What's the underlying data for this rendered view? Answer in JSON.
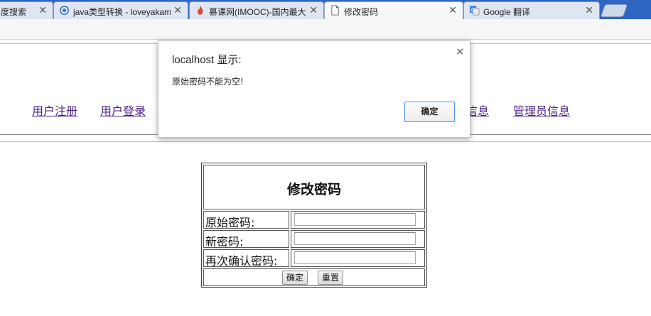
{
  "tabs": [
    {
      "title": "度搜索",
      "favicon": "baidu-icon"
    },
    {
      "title": "java类型转换 - loveyakamoz",
      "favicon": "blog-icon"
    },
    {
      "title": "慕课网(IMOOC)-国内最大",
      "favicon": "imooc-flame-icon"
    },
    {
      "title": "修改密码",
      "favicon": "page-icon",
      "active": true
    },
    {
      "title": "Google 翻译",
      "favicon": "google-translate-icon"
    }
  ],
  "tab_close_glyph": "✕",
  "nav": {
    "register": "用户注册",
    "login": "用户登录",
    "info_partial": "信息",
    "admin_info": "管理员信息"
  },
  "form": {
    "title": "修改密码",
    "old_password_label": "原始密码:",
    "new_password_label": "新密码:",
    "confirm_password_label": "再次确认密码:",
    "old_password_value": "",
    "new_password_value": "",
    "confirm_password_value": "",
    "submit_label": "确定",
    "reset_label": "重置"
  },
  "dialog": {
    "title": "localhost 显示:",
    "message": "原始密码不能为空!",
    "ok_label": "确定",
    "close_glyph": "×"
  },
  "colors": {
    "tabstrip": "#2f66c3",
    "link_visited": "#4a1f86",
    "dialog_button_border": "#4d90fe"
  }
}
